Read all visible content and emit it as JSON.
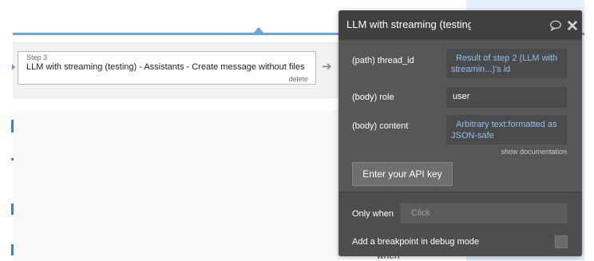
{
  "step": {
    "label": "Step 3",
    "title": "LLM with streaming (testing) - Assistants - Create message without files",
    "delete_label": "delete"
  },
  "canvas": {
    "fragment_text": "when"
  },
  "panel": {
    "title": "LLM with streaming (testing",
    "icons": {
      "comment": "comment-icon",
      "close": "close-icon"
    },
    "fields": [
      {
        "label": "(path) thread_id",
        "value": "Result of step 2 (LLM with streamin...)'s id",
        "dynamic": true
      },
      {
        "label": "(body) role",
        "value": "user",
        "dynamic": false
      },
      {
        "label": "(body) content",
        "value": "Arbitrary text:formatted as JSON-safe",
        "dynamic": true
      }
    ],
    "show_documentation_label": "show documentation",
    "api_key_button_label": "Enter your API key",
    "only_when_label": "Only when",
    "only_when_placeholder": "Click",
    "breakpoint_label": "Add a breakpoint in debug mode"
  },
  "colors": {
    "panel_bg": "#575757",
    "panel_header": "#3f3f3f",
    "dynamic_text": "#8cc0f2",
    "connector_line": "#64a6e6"
  }
}
